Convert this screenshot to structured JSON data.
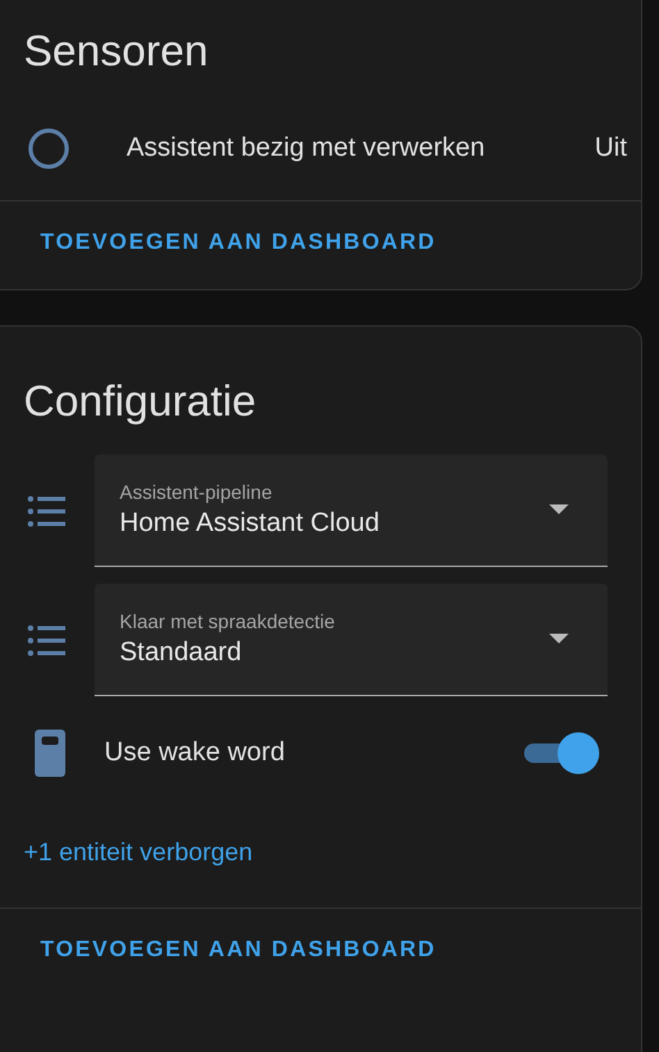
{
  "cards": [
    {
      "title": "Sensoren",
      "rows": [
        {
          "kind": "sensor",
          "label": "Assistent bezig met verwerken",
          "state": "Uit"
        }
      ],
      "action": "TOEVOEGEN AAN DASHBOARD"
    },
    {
      "title": "Configuratie",
      "rows": [
        {
          "kind": "select",
          "label": "Assistent-pipeline",
          "value": "Home Assistant Cloud"
        },
        {
          "kind": "select",
          "label": "Klaar met spraakdetectie",
          "value": "Standaard"
        },
        {
          "kind": "switch",
          "label": "Use wake word",
          "on": true
        }
      ],
      "hidden_link": "+1 entiteit verborgen",
      "action": "TOEVOEGEN AAN DASHBOARD"
    }
  ]
}
